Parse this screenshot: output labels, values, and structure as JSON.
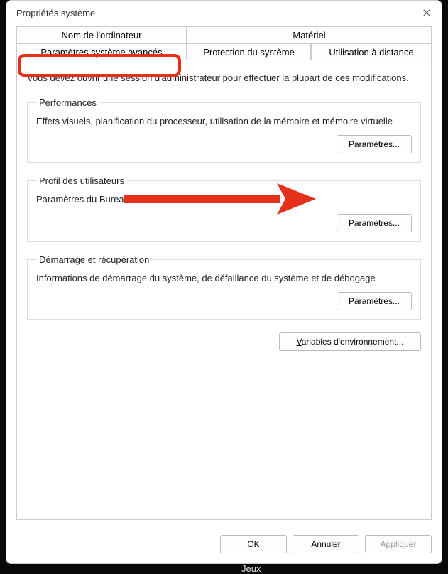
{
  "dialog": {
    "title": "Propriétés système",
    "tabs": {
      "computer_name": "Nom de l'ordinateur",
      "hardware": "Matériel",
      "advanced_params": "Paramètres système avancés",
      "system_protection": "Protection du système",
      "remote_use": "Utilisation à distance"
    },
    "intro": "Vous devez ouvrir une session d'administrateur pour effectuer la plupart de ces modifications.",
    "groups": {
      "performance": {
        "legend": "Performances",
        "desc": "Effets visuels, planification du processeur, utilisation de la mémoire et mémoire virtuelle",
        "button_prefix": "P",
        "button_rest": "aramètres..."
      },
      "user_profiles": {
        "legend": "Profil des utilisateurs",
        "desc": "Paramètres du Bureau liés à votre connexion",
        "button_pre": "P",
        "button_under": "a",
        "button_rest": "ramètres..."
      },
      "startup": {
        "legend": "Démarrage et récupération",
        "desc": "Informations de démarrage du système, de défaillance du système et de débogage",
        "button_pre": "Para",
        "button_under": "m",
        "button_rest": "ètres..."
      }
    },
    "env_vars_pre": "",
    "env_vars_under": "V",
    "env_vars_rest": "ariables d'environnement...",
    "buttons": {
      "ok": "OK",
      "cancel": "Annuler",
      "apply_pre": "",
      "apply_under": "A",
      "apply_rest": "ppliquer"
    }
  },
  "desktop": {
    "games_label": "Jeux"
  }
}
